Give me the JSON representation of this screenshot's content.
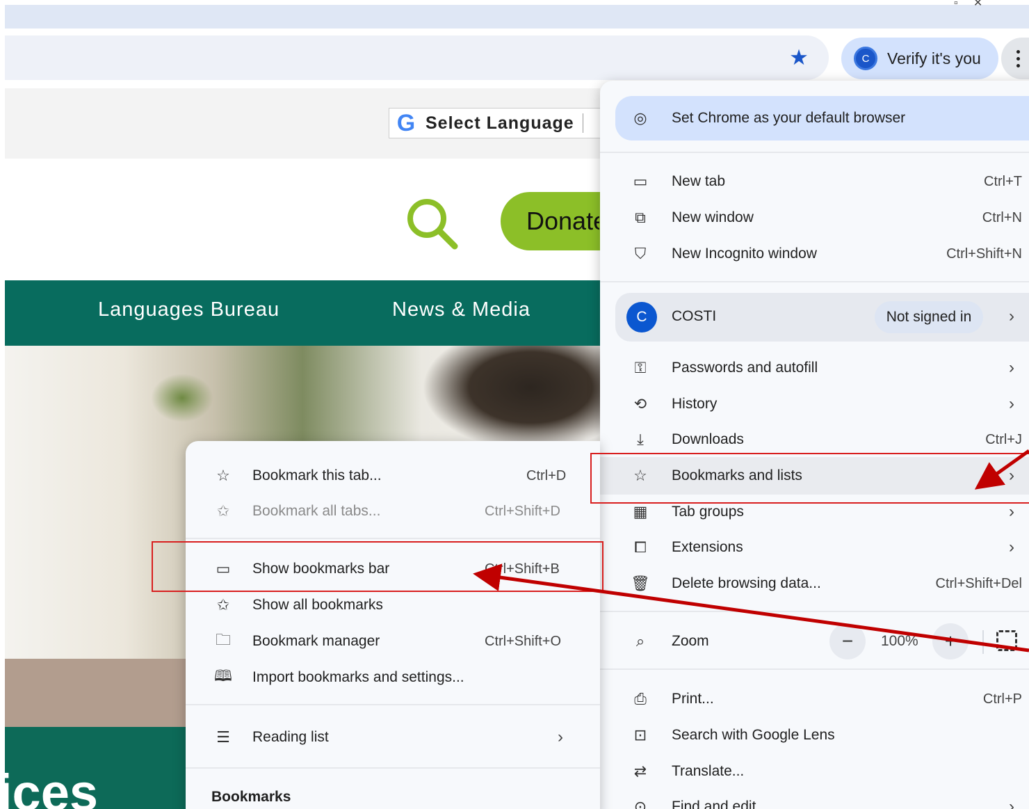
{
  "browser": {
    "verify_label": "Verify it's you",
    "verify_avatar": "C",
    "bookmark_star_icon": "star-icon",
    "accent": "#1a56c9"
  },
  "site": {
    "language_select": "Select Language",
    "google_logo": "G",
    "donate_label": "Donate",
    "nav": [
      "Languages Bureau",
      "News & Media"
    ],
    "hero_text": "ices",
    "nav_color": "#086c5e",
    "donate_color": "#8cbf28"
  },
  "main_menu": {
    "default_banner": "Set Chrome as your default browser",
    "new_tab": {
      "label": "New tab",
      "shortcut": "Ctrl+T"
    },
    "new_window": {
      "label": "New window",
      "shortcut": "Ctrl+N"
    },
    "incognito": {
      "label": "New Incognito window",
      "shortcut": "Ctrl+Shift+N"
    },
    "profile": {
      "avatar": "C",
      "name": "COSTI",
      "status": "Not signed in"
    },
    "passwords": {
      "label": "Passwords and autofill"
    },
    "history": {
      "label": "History"
    },
    "downloads": {
      "label": "Downloads",
      "shortcut": "Ctrl+J"
    },
    "bookmarks": {
      "label": "Bookmarks and lists"
    },
    "tab_groups": {
      "label": "Tab groups"
    },
    "extensions": {
      "label": "Extensions"
    },
    "delete_data": {
      "label": "Delete browsing data...",
      "shortcut": "Ctrl+Shift+Del"
    },
    "zoom": {
      "label": "Zoom",
      "minus": "−",
      "value": "100%",
      "plus": "+"
    },
    "print": {
      "label": "Print...",
      "shortcut": "Ctrl+P"
    },
    "lens": {
      "label": "Search with Google Lens"
    },
    "translate": {
      "label": "Translate..."
    },
    "find": {
      "label": "Find and edit"
    }
  },
  "sub_menu": {
    "bookmark_tab": {
      "label": "Bookmark this tab...",
      "shortcut": "Ctrl+D"
    },
    "bookmark_all": {
      "label": "Bookmark all tabs...",
      "shortcut": "Ctrl+Shift+D"
    },
    "show_bar": {
      "label": "Show bookmarks bar",
      "shortcut": "Ctrl+Shift+B"
    },
    "show_all": {
      "label": "Show all bookmarks"
    },
    "manager": {
      "label": "Bookmark manager",
      "shortcut": "Ctrl+Shift+O"
    },
    "import": {
      "label": "Import bookmarks and settings..."
    },
    "reading_list": {
      "label": "Reading list"
    },
    "bookmarks_heading": "Bookmarks"
  },
  "annotations": {
    "color": "#d81e1e"
  }
}
